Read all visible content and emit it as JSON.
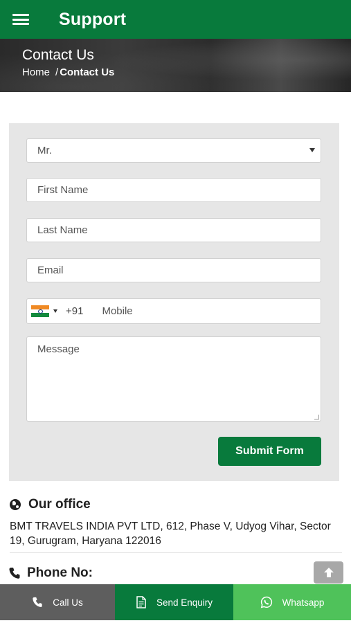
{
  "header": {
    "title": "Support",
    "menu_icon": "hamburger-menu-icon"
  },
  "hero": {
    "title": "Contact Us",
    "breadcrumb": {
      "home": "Home",
      "separator": "/",
      "current": "Contact Us"
    }
  },
  "form": {
    "salutation": "Mr.",
    "first_name_placeholder": "First Name",
    "last_name_placeholder": "Last Name",
    "email_placeholder": "Email",
    "dial_code": "+91",
    "mobile_placeholder": "Mobile",
    "message_placeholder": "Message",
    "submit_label": "Submit Form"
  },
  "office": {
    "heading": "Our office",
    "address": "BMT TRAVELS INDIA PVT LTD, 612, Phase V, Udyog Vihar, Sector 19, Gurugram, Haryana 122016"
  },
  "phone": {
    "heading": "Phone No:"
  },
  "bottom_bar": {
    "call": "Call Us",
    "enquiry": "Send Enquiry",
    "whatsapp": "Whatsapp"
  },
  "colors": {
    "brand_green": "#087a3c",
    "whatsapp_green": "#4fc25a",
    "call_gray": "#5e5e5e"
  }
}
